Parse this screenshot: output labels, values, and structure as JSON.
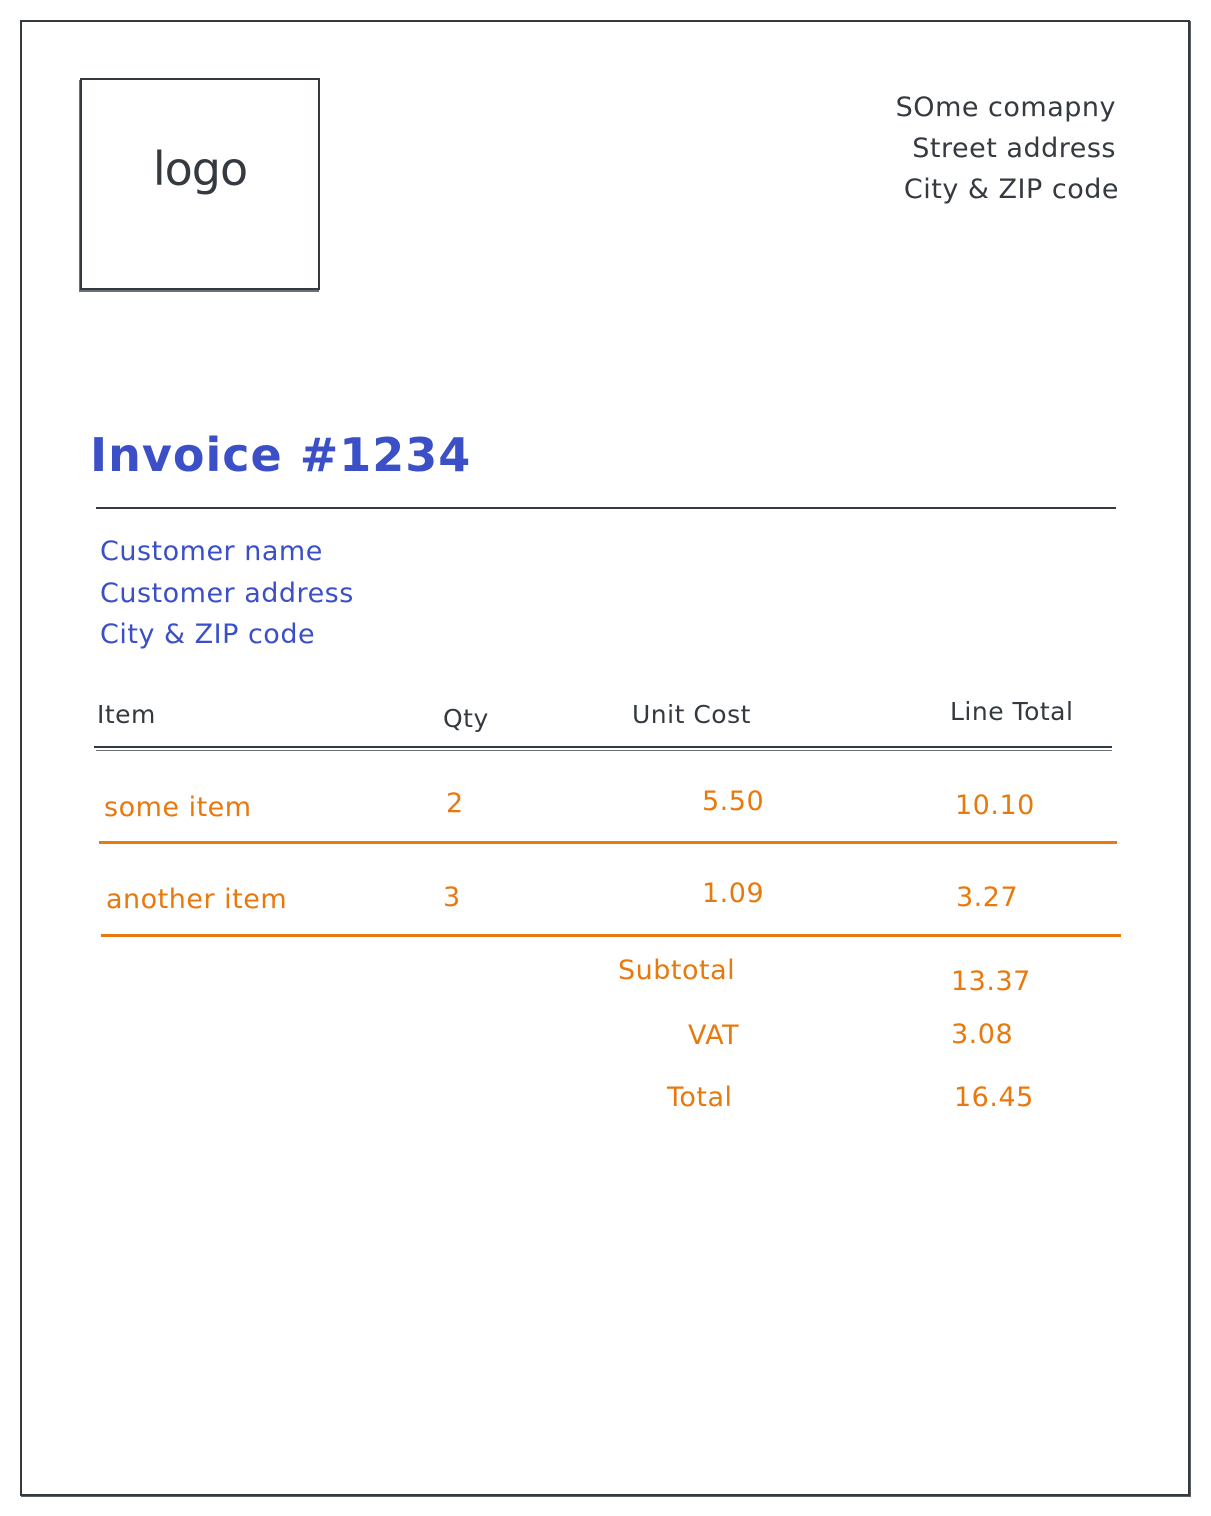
{
  "logo": {
    "label": "logo"
  },
  "company": {
    "lines": [
      "SOme comapny",
      "Street address",
      "City & ZIP code"
    ]
  },
  "invoice": {
    "title": "Invoice #1234"
  },
  "customer": {
    "lines": [
      "Customer name",
      "Customer address",
      "City & ZIP code"
    ]
  },
  "table": {
    "headers": {
      "item": "Item",
      "qty": "Qty",
      "unit_cost": "Unit Cost",
      "line_total": "Line Total"
    },
    "rows": [
      {
        "item": "some item",
        "qty": "2",
        "unit_cost": "5.50",
        "line_total": "10.10"
      },
      {
        "item": "another item",
        "qty": "3",
        "unit_cost": "1.09",
        "line_total": "3.27"
      }
    ]
  },
  "summary": {
    "subtotal_label": "Subtotal",
    "subtotal_value": "13.37",
    "vat_label": "VAT",
    "vat_value": "3.08",
    "total_label": "Total",
    "total_value": "16.45"
  },
  "colors": {
    "stroke": "#343a40",
    "accent_blue": "#3b4fc6",
    "accent_orange": "#e8790e"
  }
}
